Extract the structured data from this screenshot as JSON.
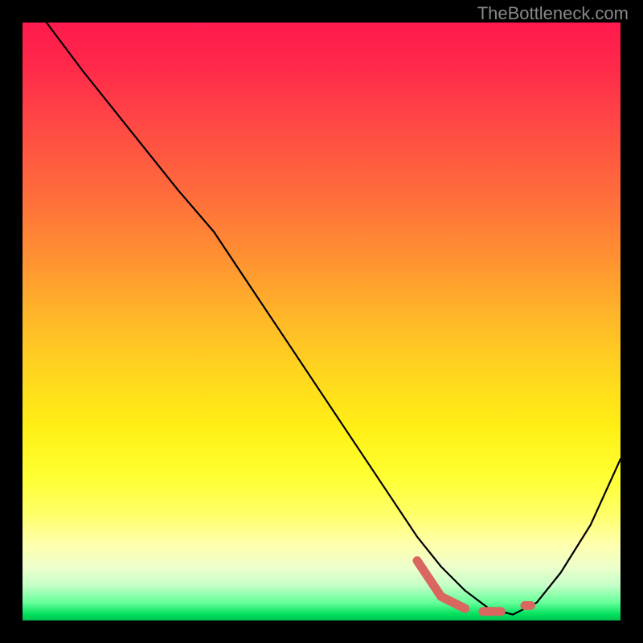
{
  "watermark": "TheBottleneck.com",
  "chart_data": {
    "type": "line",
    "title": "",
    "xlabel": "",
    "ylabel": "",
    "xlim": [
      0,
      100
    ],
    "ylim": [
      0,
      100
    ],
    "series": [
      {
        "name": "main-curve",
        "x": [
          4,
          10,
          18,
          26,
          32,
          38,
          44,
          50,
          56,
          62,
          66,
          70,
          74,
          78,
          82,
          86,
          90,
          95,
          100
        ],
        "values": [
          100,
          92,
          82,
          72,
          65,
          56,
          47,
          38,
          29,
          20,
          14,
          9,
          5,
          2,
          1,
          3,
          8,
          16,
          27
        ]
      }
    ],
    "markers": {
      "name": "highlight-dashes",
      "segments": [
        {
          "x": [
            66,
            70,
            74
          ],
          "values": [
            10,
            4,
            2
          ]
        },
        {
          "x": [
            77,
            80
          ],
          "values": [
            1.5,
            1.5
          ]
        },
        {
          "x": [
            84,
            85
          ],
          "values": [
            2.5,
            2.5
          ]
        }
      ],
      "color": "#d9675f"
    },
    "background_gradient": {
      "stops": [
        {
          "pos": 0.0,
          "color": "#ff1a4d"
        },
        {
          "pos": 0.5,
          "color": "#ffc824"
        },
        {
          "pos": 0.8,
          "color": "#ffff55"
        },
        {
          "pos": 1.0,
          "color": "#00c050"
        }
      ]
    }
  }
}
